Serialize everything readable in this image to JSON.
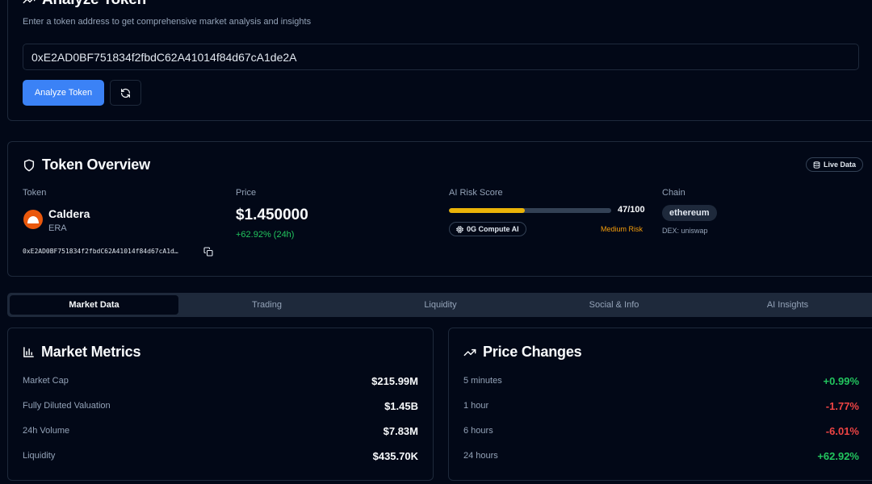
{
  "analyze": {
    "title": "Analyze Token",
    "subtitle": "Enter a token address to get comprehensive market analysis and insights",
    "address_value": "0xE2AD0BF751834f2fbdC62A41014f84d67cA1de2A",
    "analyze_button": "Analyze Token",
    "refresh_icon": "refresh-icon"
  },
  "overview": {
    "title": "Token Overview",
    "live_badge": "Live Data",
    "token_label": "Token",
    "token_name": "Caldera",
    "token_symbol": "ERA",
    "token_address": "0xE2AD0BF751834f2fbdC62A41014f84d67cA1d…",
    "price_label": "Price",
    "price": "$1.450000",
    "price_change": "+62.92% (24h)",
    "risk_label": "AI Risk Score",
    "risk_score": 47,
    "risk_score_text": "47/100",
    "ai_badge": "0G Compute AI",
    "risk_level": "Medium Risk",
    "chain_label": "Chain",
    "chain": "ethereum",
    "dex": "DEX: uniswap"
  },
  "tabs": [
    {
      "label": "Market Data",
      "active": true
    },
    {
      "label": "Trading",
      "active": false
    },
    {
      "label": "Liquidity",
      "active": false
    },
    {
      "label": "Social & Info",
      "active": false
    },
    {
      "label": "AI Insights",
      "active": false
    }
  ],
  "market_metrics": {
    "title": "Market Metrics",
    "rows": [
      {
        "label": "Market Cap",
        "value": "$215.99M"
      },
      {
        "label": "Fully Diluted Valuation",
        "value": "$1.45B"
      },
      {
        "label": "24h Volume",
        "value": "$7.83M"
      },
      {
        "label": "Liquidity",
        "value": "$435.70K"
      }
    ]
  },
  "price_changes": {
    "title": "Price Changes",
    "rows": [
      {
        "label": "5 minutes",
        "value": "+0.99%",
        "trend": "up"
      },
      {
        "label": "1 hour",
        "value": "-1.77%",
        "trend": "down"
      },
      {
        "label": "6 hours",
        "value": "-6.01%",
        "trend": "down"
      },
      {
        "label": "24 hours",
        "value": "+62.92%",
        "trend": "up"
      }
    ]
  },
  "colors": {
    "background": "#020817",
    "primary": "#3b82f6",
    "positive": "#22c55e",
    "negative": "#ef4444",
    "risk_fill": "#eab308",
    "risk_text": "#f59e0b",
    "token_logo": "#ea580c"
  }
}
